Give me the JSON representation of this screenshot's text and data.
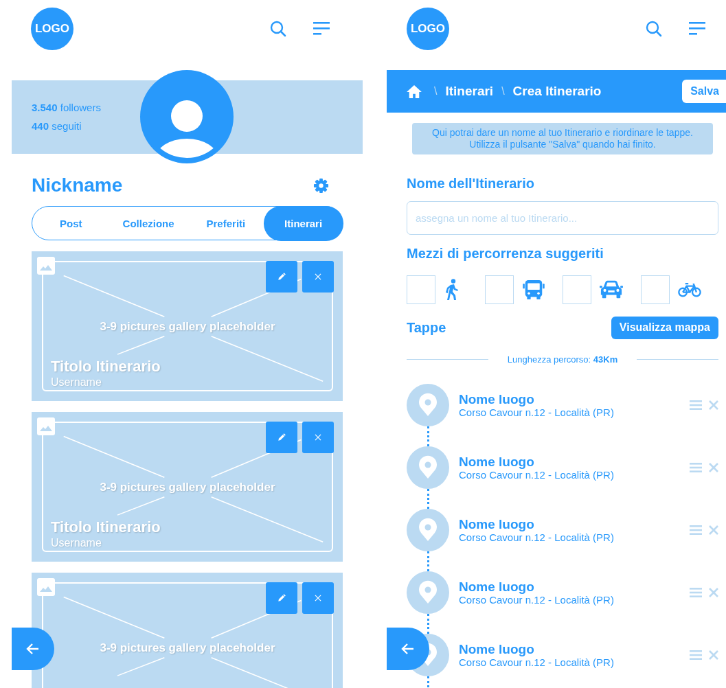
{
  "profile_screen": {
    "logo": "LOGO",
    "stats": [
      "**3.540** followers",
      "**440** seguiti"
    ],
    "nickname": "Nickname",
    "tabs": [
      {
        "label": "Post",
        "selected": false
      },
      {
        "label": "Collezione",
        "selected": false
      },
      {
        "label": "Preferiti",
        "selected": false
      },
      {
        "label": "Itinerari",
        "selected": true
      }
    ],
    "cards": [
      {
        "gallery": "3-9 pictures gallery placeholder",
        "title": "Titolo Itinerario",
        "username": "Username"
      },
      {
        "gallery": "3-9 pictures gallery placeholder",
        "title": "Titolo Itinerario",
        "username": "Username"
      },
      {
        "gallery": "3-9 pictures gallery placeholder"
      }
    ]
  },
  "create_itinerary_screen": {
    "logo": "LOGO",
    "breadcrumb": {
      "separator": "\\",
      "items": [
        "Itinerari",
        "Crea Itinerario"
      ]
    },
    "save_button": "Salva",
    "info_lines": [
      "Qui potrai dare un nome al tuo Itinerario e riordinare le tappe.",
      "Utilizza il pulsante \"Salva\" quando hai finito."
    ],
    "name_label": "Nome dell'Itinerario",
    "name_field": {
      "placeholder": "assegna un nome al tuo Itinerario..."
    },
    "transport_label": "Mezzi di percorrenza suggeriti",
    "transports": [
      {
        "kind": "walk",
        "checked": false
      },
      {
        "kind": "bus",
        "checked": false
      },
      {
        "kind": "car",
        "checked": false
      },
      {
        "kind": "bike",
        "checked": false
      }
    ],
    "stops_label": "Tappe",
    "map_button": "Visualizza mappa",
    "route_length": "Lunghezza percorso: **43Km**",
    "stops": [
      {
        "name": "Nome luogo",
        "address": "Corso Cavour n.12 - Località (PR)"
      },
      {
        "name": "Nome luogo",
        "address": "Corso Cavour n.12 - Località (PR)"
      },
      {
        "name": "Nome luogo",
        "address": "Corso Cavour n.12 - Località (PR)"
      },
      {
        "name": "Nome luogo",
        "address": "Corso Cavour n.12 - Località (PR)"
      },
      {
        "name": "Nome luogo",
        "address": "Corso Cavour n.12 - Località (PR)"
      }
    ]
  }
}
